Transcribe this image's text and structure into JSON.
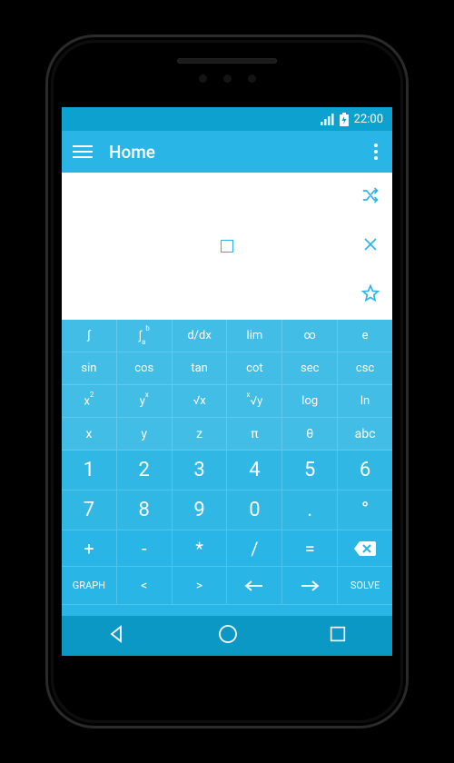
{
  "status": {
    "time": "22:00"
  },
  "appbar": {
    "title": "Home"
  },
  "canvas_actions": {
    "shuffle": "shuffle",
    "clear": "clear",
    "favorite": "favorite"
  },
  "rows": {
    "r1": [
      "∫",
      "∫ₐᵇ",
      "d/dx",
      "lim",
      "∞",
      "e"
    ],
    "r2": [
      "sin",
      "cos",
      "tan",
      "cot",
      "sec",
      "csc"
    ],
    "r3": [
      "x²",
      "yˣ",
      "√x",
      "ˣ√y",
      "log",
      "ln"
    ],
    "r4": [
      "x",
      "y",
      "z",
      "π",
      "θ",
      "abc"
    ],
    "n1": [
      "1",
      "2",
      "3",
      "4",
      "5",
      "6"
    ],
    "n2": [
      "7",
      "8",
      "9",
      "0",
      ".",
      "°"
    ],
    "ops": [
      "+",
      "-",
      "*",
      "/",
      "=",
      "⌫"
    ],
    "bot": [
      "GRAPH",
      "<",
      ">",
      "⇦",
      "⇨",
      "SOLVE"
    ]
  }
}
